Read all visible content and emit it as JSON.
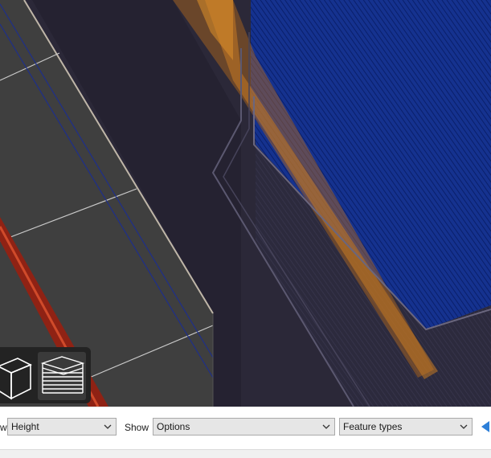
{
  "preview_toolbar": {
    "view_label_fragment": "w",
    "view_value": "Height",
    "show_label": "Show",
    "show_value": "Options",
    "feature_value": "Feature types"
  },
  "status_bar": {
    "text": ""
  },
  "icons": {
    "iso_view": "iso-cube-icon",
    "layers_view": "layer-stack-icon",
    "combo_arrow": "chevron-down-icon",
    "slider_arrow": "arrow-left-icon"
  },
  "colors": {
    "model_plate": "#3f3f3f",
    "object_travel": "#202f99",
    "perimeter_orange": "#b86a1a",
    "support_red": "#a83020",
    "background": "#2b2838"
  }
}
